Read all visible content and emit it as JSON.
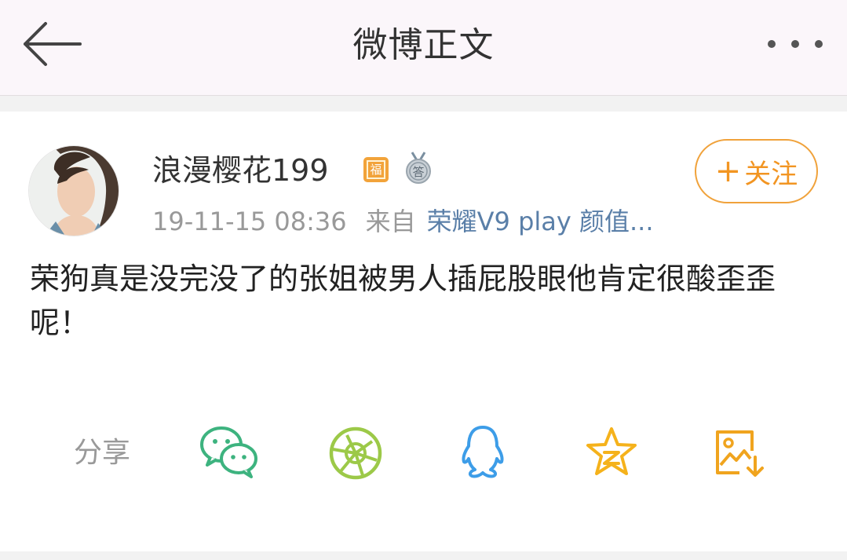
{
  "header": {
    "title": "微博正文"
  },
  "post": {
    "author": "浪漫樱花199",
    "badge_fu": "福",
    "badge_da": "答",
    "follow_label": "关注",
    "follow_plus": "+",
    "timestamp": "19-11-15 08:36",
    "source_prefix": "来自",
    "source_device": "荣耀V9 play 颜值...",
    "content": "荣狗真是没完没了的张姐被男人插屁股眼他肯定很酸歪歪呢！"
  },
  "share": {
    "label": "分享",
    "targets": [
      "wechat-icon",
      "moments-icon",
      "qq-icon",
      "qzone-icon",
      "save-image-icon"
    ]
  },
  "colors": {
    "accent_orange": "#f29522",
    "wechat": "#3db37f",
    "moments": "#9cc948",
    "qq": "#3d9de8",
    "qzone": "#f5b21b",
    "save": "#f0a41e",
    "link": "#5a7fa8"
  }
}
